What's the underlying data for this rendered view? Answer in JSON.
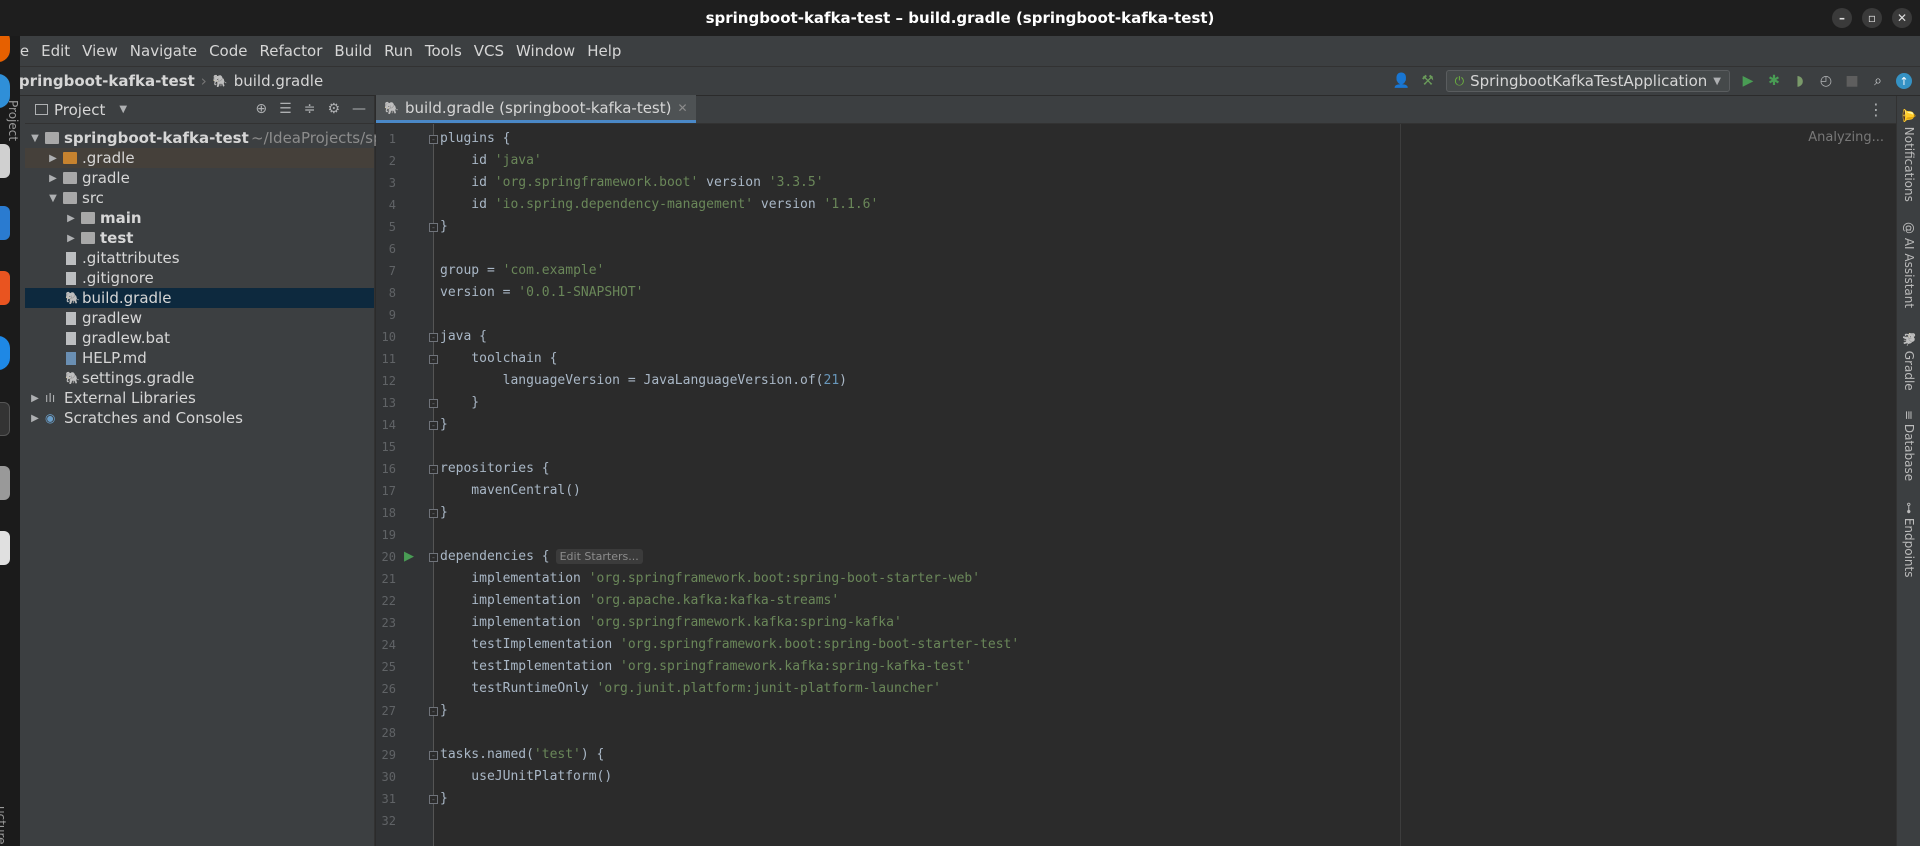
{
  "window": {
    "title": "springboot-kafka-test – build.gradle (springboot-kafka-test)",
    "controls": [
      "–",
      "▫",
      "✕"
    ]
  },
  "menu": [
    "File",
    "Edit",
    "View",
    "Navigate",
    "Code",
    "Refactor",
    "Build",
    "Run",
    "Tools",
    "VCS",
    "Window",
    "Help"
  ],
  "breadcrumb": {
    "project": "springboot-kafka-test",
    "file": "build.gradle"
  },
  "toolbar": {
    "run_config": "SpringbootKafkaTestApplication"
  },
  "project_panel": {
    "title": "Project",
    "tree": [
      {
        "label": "springboot-kafka-test",
        "suffix": "~/IdeaProjects/sprin",
        "bold": true
      },
      {
        "label": ".gradle"
      },
      {
        "label": "gradle"
      },
      {
        "label": "src"
      },
      {
        "label": "main",
        "bold": true
      },
      {
        "label": "test",
        "bold": true
      },
      {
        "label": ".gitattributes"
      },
      {
        "label": ".gitignore"
      },
      {
        "label": "build.gradle"
      },
      {
        "label": "gradlew"
      },
      {
        "label": "gradlew.bat"
      },
      {
        "label": "HELP.md"
      },
      {
        "label": "settings.gradle"
      },
      {
        "label": "External Libraries"
      },
      {
        "label": "Scratches and Consoles"
      }
    ]
  },
  "editor": {
    "tab_label": "build.gradle (springboot-kafka-test)",
    "status": "Analyzing...",
    "inlay_hint": "Edit Starters...",
    "line_numbers": [
      "1",
      "2",
      "3",
      "4",
      "5",
      "6",
      "7",
      "8",
      "9",
      "10",
      "11",
      "12",
      "13",
      "14",
      "15",
      "16",
      "17",
      "18",
      "19",
      "20",
      "21",
      "22",
      "23",
      "24",
      "25",
      "26",
      "27",
      "28",
      "29",
      "30",
      "31",
      "32"
    ],
    "lines": [
      "plugins {",
      "    id 'java'",
      "    id 'org.springframework.boot' version '3.3.5'",
      "    id 'io.spring.dependency-management' version '1.1.6'",
      "}",
      "",
      "group = 'com.example'",
      "version = '0.0.1-SNAPSHOT'",
      "",
      "java {",
      "    toolchain {",
      "        languageVersion = JavaLanguageVersion.of(21)",
      "    }",
      "}",
      "",
      "repositories {",
      "    mavenCentral()",
      "}",
      "",
      "dependencies {",
      "    implementation 'org.springframework.boot:spring-boot-starter-web'",
      "    implementation 'org.apache.kafka:kafka-streams'",
      "    implementation 'org.springframework.kafka:spring-kafka'",
      "    testImplementation 'org.springframework.boot:spring-boot-starter-test'",
      "    testImplementation 'org.springframework.kafka:spring-kafka-test'",
      "    testRuntimeOnly 'org.junit.platform:junit-platform-launcher'",
      "}",
      "",
      "tasks.named('test') {",
      "    useJUnitPlatform()",
      "}",
      ""
    ]
  },
  "right_tool_windows": [
    "Notifications",
    "AI Assistant",
    "Gradle",
    "Database",
    "Endpoints"
  ],
  "left_tool_windows": [
    "Project",
    "ucture"
  ]
}
